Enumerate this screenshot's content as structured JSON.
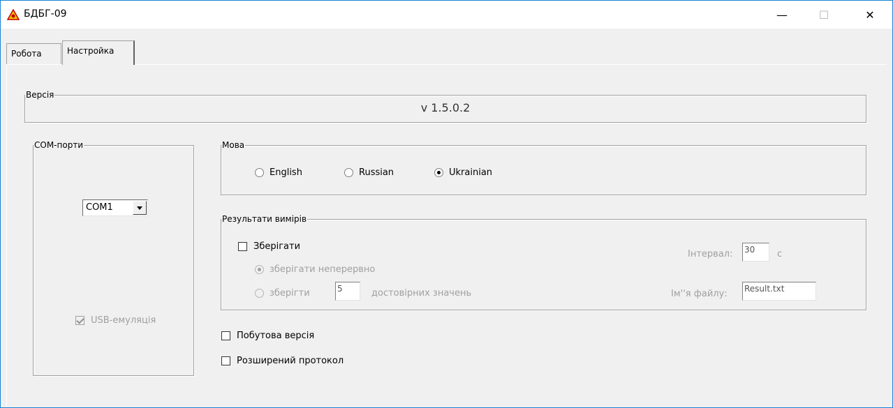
{
  "window": {
    "title": "БДБГ-09",
    "icon": "warning-logo-icon",
    "minimize_glyph": "—",
    "maximize_glyph": "☐",
    "close_glyph": "✕"
  },
  "tabs": [
    {
      "label": "Робота",
      "active": false
    },
    {
      "label": "Настройка",
      "active": true
    }
  ],
  "version_group": {
    "label": "Версія",
    "value": "v 1.5.0.2"
  },
  "com_group": {
    "label": "COM-порти",
    "selected_port": "COM1",
    "usb_emulation_label": "USB-емуляція",
    "usb_emulation_checked": true
  },
  "language_group": {
    "label": "Мова",
    "options": [
      {
        "label": "English",
        "selected": false
      },
      {
        "label": "Russian",
        "selected": false
      },
      {
        "label": "Ukrainian",
        "selected": true
      }
    ]
  },
  "results_group": {
    "label": "Результати вимірів",
    "save_label": "Зберігати",
    "save_checked": false,
    "continuous_label": "зберігати неперервно",
    "continuous_selected": true,
    "store_label": "зберігти",
    "store_count": "5",
    "store_suffix": "достовірних значень",
    "interval_label": "Інтервал:",
    "interval_value": "30",
    "interval_unit": "с",
    "filename_label": "Ім''я файлу:",
    "filename_value": "Result.txt"
  },
  "options": {
    "household_label": "Побутова версія",
    "household_checked": false,
    "extended_protocol_label": "Розширений протокол",
    "extended_protocol_checked": false
  },
  "colors": {
    "accent_border": "#1883d7",
    "panel": "#f0f0f0",
    "disabled_text": "#a0a0a0"
  }
}
